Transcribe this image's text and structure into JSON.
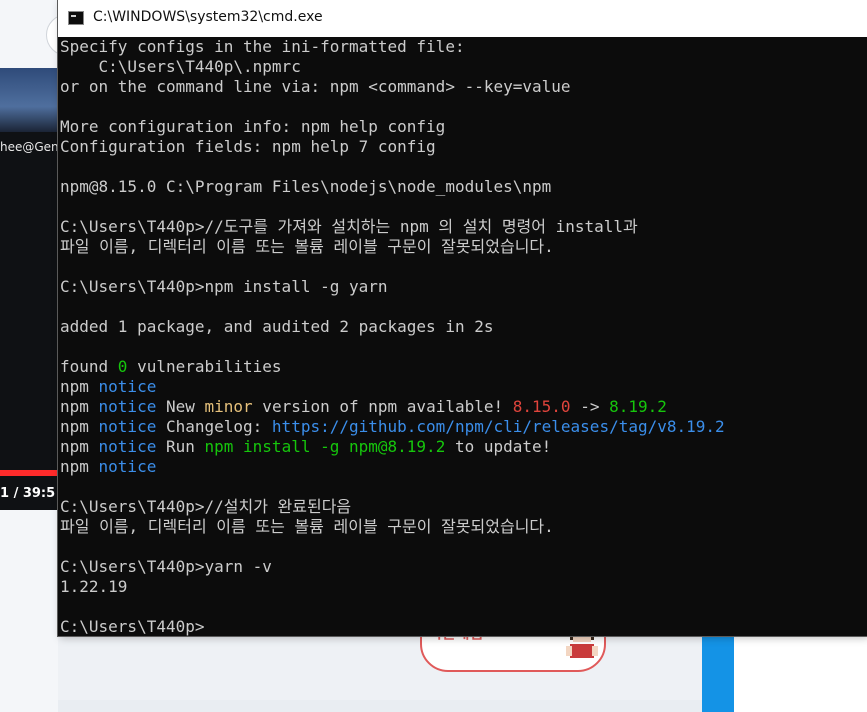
{
  "window": {
    "title": "C:\\WINDOWS\\system32\\cmd.exe"
  },
  "background": {
    "video_user_text": "hee@Gen",
    "video_time": "1 /  39:5",
    "card_text": "시간네업"
  },
  "console": {
    "lines": [
      {
        "parts": [
          {
            "t": "Specify configs in the ini-formatted file:",
            "c": ""
          }
        ]
      },
      {
        "parts": [
          {
            "t": "    C:\\Users\\T440p\\.npmrc",
            "c": ""
          }
        ]
      },
      {
        "parts": [
          {
            "t": "or on the command line via: npm <command> --key=value",
            "c": ""
          }
        ]
      },
      {
        "parts": [
          {
            "t": "",
            "c": ""
          }
        ]
      },
      {
        "parts": [
          {
            "t": "More configuration info: npm help config",
            "c": ""
          }
        ]
      },
      {
        "parts": [
          {
            "t": "Configuration fields: npm help 7 config",
            "c": ""
          }
        ]
      },
      {
        "parts": [
          {
            "t": "",
            "c": ""
          }
        ]
      },
      {
        "parts": [
          {
            "t": "npm@8.15.0 C:\\Program Files\\nodejs\\node_modules\\npm",
            "c": ""
          }
        ]
      },
      {
        "parts": [
          {
            "t": "",
            "c": ""
          }
        ]
      },
      {
        "parts": [
          {
            "t": "C:\\Users\\T440p>//도구를 가져와 설치하는 npm 의 설치 명령어 install과",
            "c": ""
          }
        ]
      },
      {
        "parts": [
          {
            "t": "파일 이름, 디렉터리 이름 또는 볼륨 레이블 구문이 잘못되었습니다.",
            "c": ""
          }
        ]
      },
      {
        "parts": [
          {
            "t": "",
            "c": ""
          }
        ]
      },
      {
        "parts": [
          {
            "t": "C:\\Users\\T440p>npm install -g yarn",
            "c": ""
          }
        ]
      },
      {
        "parts": [
          {
            "t": "",
            "c": ""
          }
        ]
      },
      {
        "parts": [
          {
            "t": "added 1 package, and audited 2 packages in 2s",
            "c": ""
          }
        ]
      },
      {
        "parts": [
          {
            "t": "",
            "c": ""
          }
        ]
      },
      {
        "parts": [
          {
            "t": "found ",
            "c": ""
          },
          {
            "t": "0",
            "c": "green"
          },
          {
            "t": " vulnerabilities",
            "c": ""
          }
        ]
      },
      {
        "parts": [
          {
            "t": "npm ",
            "c": ""
          },
          {
            "t": "notice",
            "c": "blue"
          }
        ]
      },
      {
        "parts": [
          {
            "t": "npm ",
            "c": ""
          },
          {
            "t": "notice",
            "c": "blue"
          },
          {
            "t": " New ",
            "c": ""
          },
          {
            "t": "minor",
            "c": "yellow"
          },
          {
            "t": " version of npm available! ",
            "c": ""
          },
          {
            "t": "8.15.0",
            "c": "red"
          },
          {
            "t": " -> ",
            "c": ""
          },
          {
            "t": "8.19.2",
            "c": "green"
          }
        ]
      },
      {
        "parts": [
          {
            "t": "npm ",
            "c": ""
          },
          {
            "t": "notice",
            "c": "blue"
          },
          {
            "t": " Changelog: ",
            "c": ""
          },
          {
            "t": "https://github.com/npm/cli/releases/tag/v8.19.2",
            "c": "cyan"
          }
        ]
      },
      {
        "parts": [
          {
            "t": "npm ",
            "c": ""
          },
          {
            "t": "notice",
            "c": "blue"
          },
          {
            "t": " Run ",
            "c": ""
          },
          {
            "t": "npm install -g npm@8.19.2",
            "c": "green"
          },
          {
            "t": " to update!",
            "c": ""
          }
        ]
      },
      {
        "parts": [
          {
            "t": "npm ",
            "c": ""
          },
          {
            "t": "notice",
            "c": "blue"
          }
        ]
      },
      {
        "parts": [
          {
            "t": "",
            "c": ""
          }
        ]
      },
      {
        "parts": [
          {
            "t": "C:\\Users\\T440p>//설치가 완료된다음",
            "c": ""
          }
        ]
      },
      {
        "parts": [
          {
            "t": "파일 이름, 디렉터리 이름 또는 볼륨 레이블 구문이 잘못되었습니다.",
            "c": ""
          }
        ]
      },
      {
        "parts": [
          {
            "t": "",
            "c": ""
          }
        ]
      },
      {
        "parts": [
          {
            "t": "C:\\Users\\T440p>yarn -v",
            "c": ""
          }
        ]
      },
      {
        "parts": [
          {
            "t": "1.22.19",
            "c": ""
          }
        ]
      },
      {
        "parts": [
          {
            "t": "",
            "c": ""
          }
        ]
      },
      {
        "parts": [
          {
            "t": "C:\\Users\\T440p>",
            "c": ""
          }
        ]
      }
    ]
  },
  "colors": {
    "console_bg": "#0c0c0c",
    "console_text": "#cccccc",
    "blue": "#3b8eea",
    "yellow": "#e5c07b",
    "red": "#e0443c",
    "green": "#16c60c"
  }
}
